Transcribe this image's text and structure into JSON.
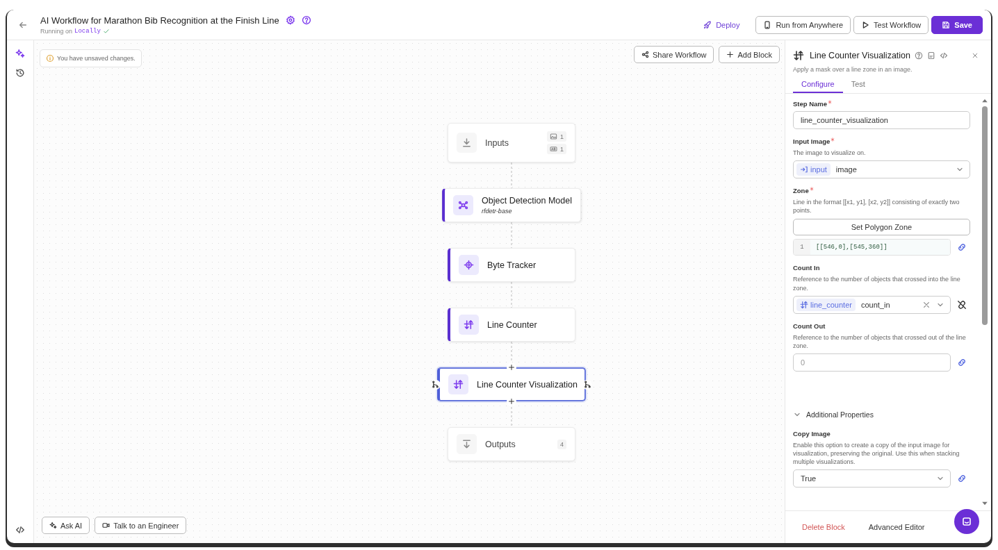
{
  "header": {
    "title": "AI Workflow for Marathon Bib Recognition at the Finish Line",
    "running_label": "Running on",
    "running_value": "Locally",
    "actions": [
      {
        "kind": "link",
        "label": "Deploy"
      },
      {
        "kind": "device",
        "label": "Run from Anywhere"
      },
      {
        "kind": "test",
        "label": "Test Workflow"
      },
      {
        "kind": "save",
        "label": "Save"
      }
    ]
  },
  "notice": "You have unsaved changes.",
  "canvas_actions": [
    {
      "kind": "share",
      "label": "Share Workflow"
    },
    {
      "kind": "add",
      "label": "Add Block"
    }
  ],
  "nodes": [
    {
      "kind": "inputs",
      "label": "Inputs",
      "selected": false,
      "badges": [
        {
          "kind": "image",
          "count": "1"
        },
        {
          "kind": "text",
          "count": "1"
        }
      ]
    },
    {
      "kind": "model",
      "label": "Object Detection Model",
      "subtitle": "rfdetr-base",
      "selected": false
    },
    {
      "kind": "tracker",
      "label": "Byte Tracker",
      "selected": false
    },
    {
      "kind": "counter",
      "label": "Line Counter",
      "selected": false
    },
    {
      "kind": "counter",
      "label": "Line Counter Visualization",
      "selected": true
    },
    {
      "kind": "outputs",
      "label": "Outputs",
      "selected": false,
      "badges": [
        {
          "kind": "plain",
          "count": "4"
        }
      ]
    }
  ],
  "bottom_actions": [
    {
      "kind": "ai",
      "label": "Ask AI"
    },
    {
      "kind": "video",
      "label": "Talk to an Engineer"
    }
  ],
  "panel": {
    "title": "Line Counter Visualization",
    "description": "Apply a mask over a line zone in an image.",
    "tabs": [
      {
        "label": "Configure",
        "selected": true
      },
      {
        "label": "Test",
        "selected": false
      }
    ],
    "fields": [
      {
        "kind": "text",
        "label": "Step Name",
        "required": true,
        "value": "line_counter_visualization"
      },
      {
        "kind": "reference",
        "label": "Input Image",
        "required": true,
        "description": "The image to visualize on.",
        "source": {
          "kind": "input",
          "label": "input"
        },
        "value": "image",
        "clearable": false
      },
      {
        "kind": "zone",
        "label": "Zone",
        "required": true,
        "description": "Line in the format [[x1, y1], [x2, y2]] consisting of exactly two points.",
        "button": "Set Polygon Zone",
        "line_number": "1",
        "code": "[[546,0],[545,360]]",
        "linked": true
      },
      {
        "kind": "reference",
        "label": "Count In",
        "required": false,
        "description": "Reference to the number of objects that crossed into the line zone.",
        "source": {
          "kind": "step",
          "label": "line_counter"
        },
        "value": "count_in",
        "clearable": true,
        "linked": false
      },
      {
        "kind": "number",
        "label": "Count Out",
        "required": false,
        "description": "Reference to the number of objects that crossed out of the line zone.",
        "placeholder": "0",
        "linked": true
      },
      {
        "kind": "section",
        "label": "Additional Properties",
        "expanded": true
      },
      {
        "kind": "select",
        "label": "Copy Image",
        "required": false,
        "description": "Enable this option to create a copy of the input image for visualization, preserving the original. Use this when stacking multiple visualizations.",
        "value": "True",
        "linked": true
      }
    ],
    "footer": [
      {
        "kind": "danger",
        "label": "Delete Block"
      },
      {
        "kind": "plain",
        "label": "Advanced Editor"
      }
    ]
  }
}
